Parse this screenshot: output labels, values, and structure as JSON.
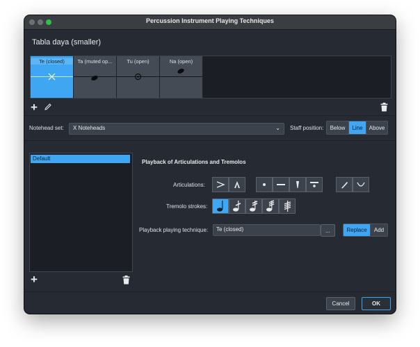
{
  "window": {
    "title": "Percussion Instrument Playing Techniques"
  },
  "instrument_name": "Tabla daya (smaller)",
  "techniques": [
    {
      "label": "Te (closed)",
      "selected": true,
      "notehead": "x-notehead-icon"
    },
    {
      "label": "Ta (muted op...",
      "selected": false,
      "notehead": "filled-notehead-icon"
    },
    {
      "label": "Tu (open)",
      "selected": false,
      "notehead": "circled-dot-notehead-icon"
    },
    {
      "label": "Na (open)",
      "selected": false,
      "notehead": "filled-notehead-icon"
    }
  ],
  "notehead_set": {
    "label": "Notehead set:",
    "value": "X Noteheads"
  },
  "staff_position": {
    "label": "Staff position:",
    "options": [
      "Below",
      "Line",
      "Above"
    ],
    "selected": "Line"
  },
  "sets_list": {
    "items": [
      "Default"
    ]
  },
  "playback": {
    "heading": "Playback of Articulations and Tremolos",
    "articulations_label": "Articulations:",
    "tremolo_label": "Tremolo strokes:",
    "technique_label": "Playback playing technique:",
    "technique_value": "Te (closed)",
    "more_label": "...",
    "replace_label": "Replace",
    "add_label": "Add"
  },
  "footer": {
    "cancel_label": "Cancel",
    "ok_label": "OK"
  },
  "colors": {
    "accent": "#3ea6f3",
    "window_bg": "#262b33",
    "panel_bg": "#1b1f25"
  }
}
